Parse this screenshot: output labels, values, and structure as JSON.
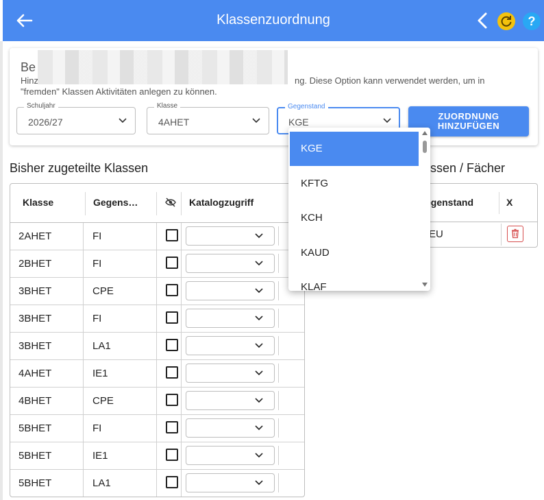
{
  "appbar": {
    "title": "Klassenzuordnung"
  },
  "card": {
    "heading": "Be",
    "desc_line1_start": "Hinz",
    "desc_line1_end": "ng. Diese Option kann verwendet werden, um in",
    "desc_line2": "\"fremden\" Klassen Aktivitäten anlegen zu können.",
    "fields": {
      "schuljahr": {
        "label": "Schuljahr",
        "value": "2026/27"
      },
      "klasse": {
        "label": "Klasse",
        "value": "4AHET"
      },
      "gegenstand": {
        "label": "Gegenstand",
        "value": "KGE"
      }
    },
    "add_button": [
      "ZUORDNUNG",
      "HINZUFÜGEN"
    ]
  },
  "assigned": {
    "title": "Bisher zugeteilte Klassen",
    "headers": {
      "klasse": "Klasse",
      "gegenstand": "Gegens…",
      "katalog": "Katalogzugriff"
    },
    "rows": [
      {
        "klasse": "2AHET",
        "gegenstand": "FI"
      },
      {
        "klasse": "2BHET",
        "gegenstand": "FI"
      },
      {
        "klasse": "3BHET",
        "gegenstand": "CPE"
      },
      {
        "klasse": "3BHET",
        "gegenstand": "FI"
      },
      {
        "klasse": "3BHET",
        "gegenstand": "LA1"
      },
      {
        "klasse": "4AHET",
        "gegenstand": "IE1"
      },
      {
        "klasse": "4BHET",
        "gegenstand": "CPE"
      },
      {
        "klasse": "5BHET",
        "gegenstand": "FI"
      },
      {
        "klasse": "5BHET",
        "gegenstand": "IE1"
      },
      {
        "klasse": "5BHET",
        "gegenstand": "LA1"
      }
    ]
  },
  "right": {
    "title": "ssen / Fächer",
    "headers": {
      "gegenstand": "egenstand",
      "x": "X"
    },
    "rows": [
      {
        "gegenstand": "EU"
      }
    ]
  },
  "dropdown": {
    "options": [
      "KGE",
      "KFTG",
      "KCH",
      "KAUD",
      "KLAF"
    ],
    "selected": "KGE"
  },
  "colors": {
    "primary": "#4a8af0",
    "refresh": "#f4c20d",
    "help": "#29a8f4",
    "delete": "#d64d4d"
  }
}
